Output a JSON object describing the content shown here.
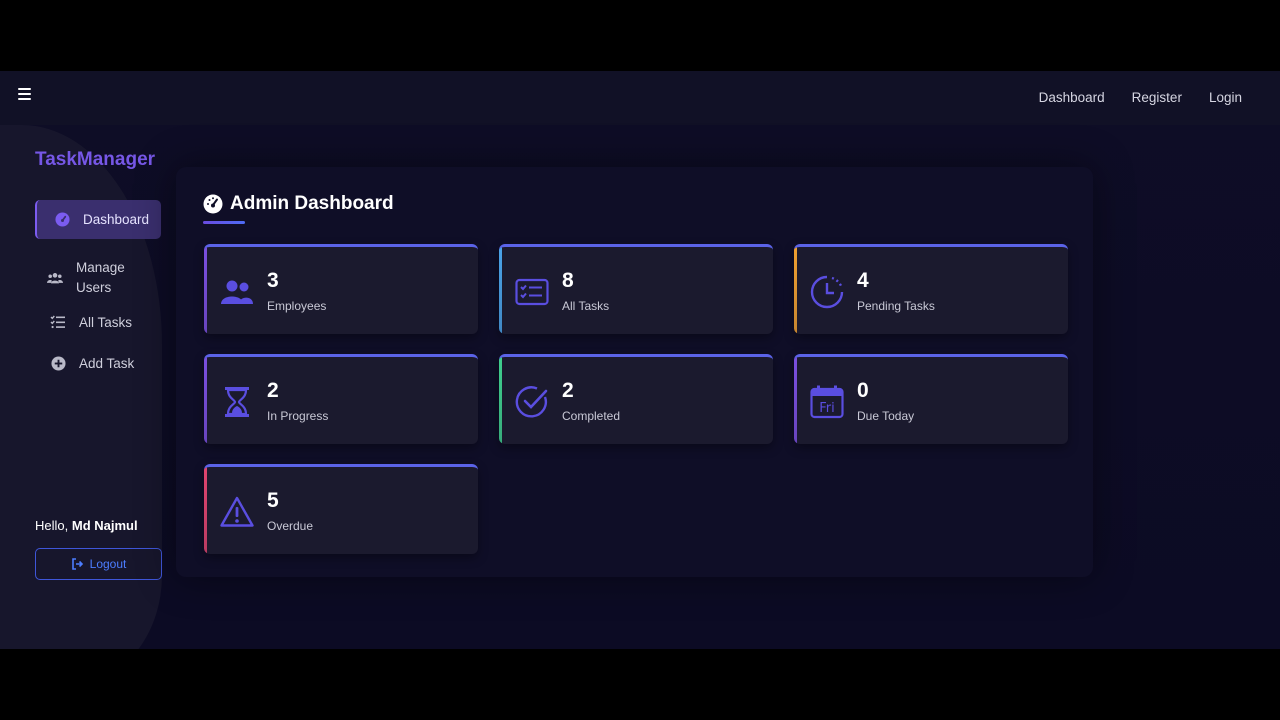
{
  "topnav": {
    "dashboard": "Dashboard",
    "register": "Register",
    "login": "Login"
  },
  "sidebar": {
    "brand": "TaskManager",
    "items": [
      {
        "label": "Dashboard",
        "icon": "gauge-icon"
      },
      {
        "label": "Manage Users",
        "line1": "Manage",
        "line2": "Users",
        "icon": "users-icon"
      },
      {
        "label": "All Tasks",
        "icon": "list-check-icon"
      },
      {
        "label": "Add Task",
        "icon": "plus-circle-icon"
      }
    ],
    "greeting": "Hello,",
    "user_name": "Md Najmul",
    "logout": "Logout"
  },
  "main": {
    "title": "Admin Dashboard",
    "cards": [
      {
        "value": "3",
        "label": "Employees",
        "icon": "users-icon",
        "accent": "#7b4fe0"
      },
      {
        "value": "8",
        "label": "All Tasks",
        "icon": "task-list-icon",
        "accent": "#4aa3e8"
      },
      {
        "value": "4",
        "label": "Pending Tasks",
        "icon": "clock-icon",
        "accent": "#f0a030"
      },
      {
        "value": "2",
        "label": "In Progress",
        "icon": "hourglass-icon",
        "accent": "#7b4fe0"
      },
      {
        "value": "2",
        "label": "Completed",
        "icon": "check-circle-icon",
        "accent": "#3fcf8e"
      },
      {
        "value": "0",
        "label": "Due Today",
        "icon": "calendar-icon",
        "icon_text": "Fri",
        "accent": "#7b4fe0"
      },
      {
        "value": "5",
        "label": "Overdue",
        "icon": "warning-icon",
        "accent": "#e0446f"
      }
    ]
  },
  "colors": {
    "brand": "#7657e6",
    "icon": "#5a4ee0",
    "logout": "#4c7dff"
  }
}
